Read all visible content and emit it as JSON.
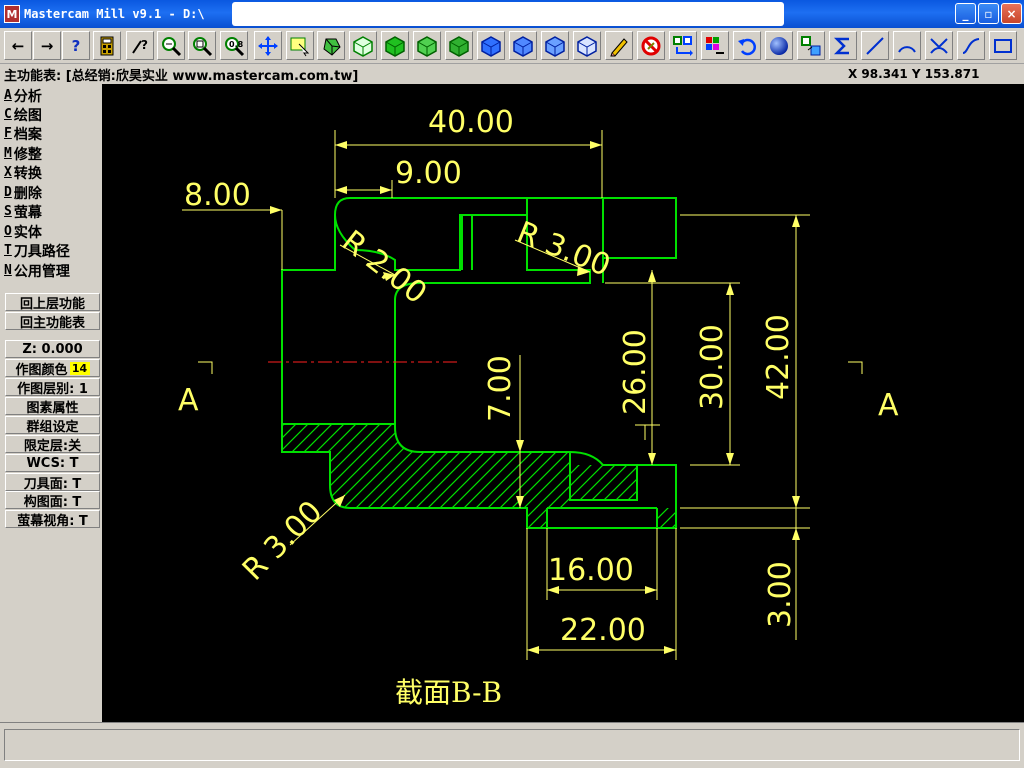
{
  "window": {
    "title": "Mastercam Mill v9.1 - D:\\",
    "icon_label": "M",
    "minimize": "_",
    "maximize": "▫",
    "close": "×"
  },
  "toolbar": {
    "back": "←",
    "forward": "→",
    "help": "?"
  },
  "infobar": {
    "menu_title": "主功能表: [总经销:欣昊实业 www.mastercam.com.tw]",
    "coords": "X 98.341  Y 153.871"
  },
  "sidebar": {
    "menu": [
      {
        "key": "A",
        "label": "分析"
      },
      {
        "key": "C",
        "label": "绘图"
      },
      {
        "key": "F",
        "label": "档案"
      },
      {
        "key": "M",
        "label": "修整"
      },
      {
        "key": "X",
        "label": "转换"
      },
      {
        "key": "D",
        "label": "删除"
      },
      {
        "key": "S",
        "label": "萤幕"
      },
      {
        "key": "O",
        "label": "实体"
      },
      {
        "key": "T",
        "label": "刀具路径"
      },
      {
        "key": "N",
        "label": "公用管理"
      }
    ],
    "back_prev": "回上层功能",
    "back_main": "回主功能表",
    "z_value": "Z:   0.000",
    "color_label": "作图颜色",
    "color_value": "14",
    "level": "作图层别: 1",
    "attributes": "图素属性",
    "group": "群组设定",
    "mask": "限定层:关",
    "wcs": "WCS:  T",
    "tool_plane": "刀具面: T",
    "construction_plane": "构图面: T",
    "view": "萤幕视角: T"
  },
  "drawing": {
    "dims": {
      "d40": "40.00",
      "d9": "9.00",
      "d8": "8.00",
      "r2": "R 2.00",
      "r3_top": "R 3.00",
      "d26": "26.00",
      "d30": "30.00",
      "d42": "42.00",
      "d7": "7.00",
      "r3_bottom": "R 3.00",
      "d16": "16.00",
      "d22": "22.00",
      "d3": "3.00"
    },
    "section_label_left": "A",
    "section_label_right": "A",
    "caption": "截面B-B",
    "colors": {
      "outline": "#00e000",
      "dimension": "#ffff66",
      "centerline": "#ff2020"
    }
  },
  "status": {
    "message": ""
  }
}
